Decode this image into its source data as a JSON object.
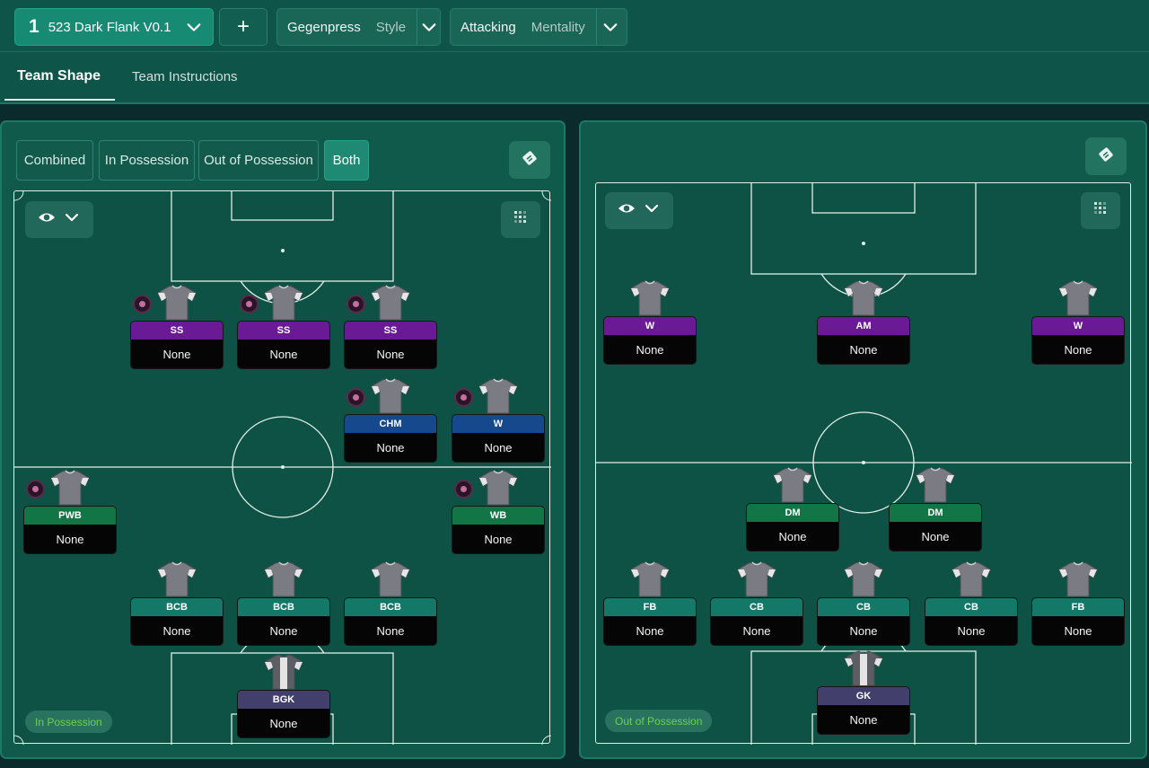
{
  "header": {
    "tactic_number": "1",
    "tactic_name": "523 Dark Flank V0.1",
    "add_label": "+",
    "style": {
      "value": "Gegenpress",
      "label": "Style"
    },
    "mentality": {
      "value": "Attacking",
      "label": "Mentality"
    }
  },
  "tabs": [
    {
      "label": "Team Shape",
      "active": true
    },
    {
      "label": "Team Instructions",
      "active": false
    }
  ],
  "left_panel": {
    "segments": [
      {
        "label": "Combined",
        "selected": false
      },
      {
        "label": "In Possession",
        "selected": false
      },
      {
        "label": "Out of Possession",
        "selected": false
      },
      {
        "label": "Both",
        "selected": true
      }
    ],
    "phase_label": "In Possession",
    "players": [
      {
        "role": "SS",
        "name": "None",
        "color": "purple",
        "badge": true
      },
      {
        "role": "SS",
        "name": "None",
        "color": "purple",
        "badge": true
      },
      {
        "role": "SS",
        "name": "None",
        "color": "purple",
        "badge": true
      },
      {
        "role": "CHM",
        "name": "None",
        "color": "blue",
        "badge": true
      },
      {
        "role": "W",
        "name": "None",
        "color": "blue",
        "badge": true
      },
      {
        "role": "PWB",
        "name": "None",
        "color": "green",
        "badge": true
      },
      {
        "role": "WB",
        "name": "None",
        "color": "green",
        "badge": true
      },
      {
        "role": "BCB",
        "name": "None",
        "color": "teal",
        "badge": false
      },
      {
        "role": "BCB",
        "name": "None",
        "color": "teal",
        "badge": false
      },
      {
        "role": "BCB",
        "name": "None",
        "color": "teal",
        "badge": false
      },
      {
        "role": "BGK",
        "name": "None",
        "color": "slate",
        "badge": false
      }
    ]
  },
  "right_panel": {
    "phase_label": "Out of Possession",
    "players": [
      {
        "role": "W",
        "name": "None",
        "color": "purple"
      },
      {
        "role": "AM",
        "name": "None",
        "color": "purple"
      },
      {
        "role": "W",
        "name": "None",
        "color": "purple"
      },
      {
        "role": "DM",
        "name": "None",
        "color": "green"
      },
      {
        "role": "DM",
        "name": "None",
        "color": "green"
      },
      {
        "role": "FB",
        "name": "None",
        "color": "teal"
      },
      {
        "role": "CB",
        "name": "None",
        "color": "teal"
      },
      {
        "role": "CB",
        "name": "None",
        "color": "teal"
      },
      {
        "role": "CB",
        "name": "None",
        "color": "teal"
      },
      {
        "role": "FB",
        "name": "None",
        "color": "teal"
      },
      {
        "role": "GK",
        "name": "None",
        "color": "slate"
      }
    ]
  },
  "icons": {
    "eye": "eye-icon",
    "chevron": "chevron-down-icon",
    "grid": "grid-icon",
    "tactics_board": "tactics-board-icon",
    "badge": "player-trait-icon"
  },
  "colors": {
    "purple": "#6a1a95",
    "blue": "#16488e",
    "green": "#127545",
    "teal": "#137868",
    "slate": "#433f6c",
    "accent": "#178a74"
  }
}
